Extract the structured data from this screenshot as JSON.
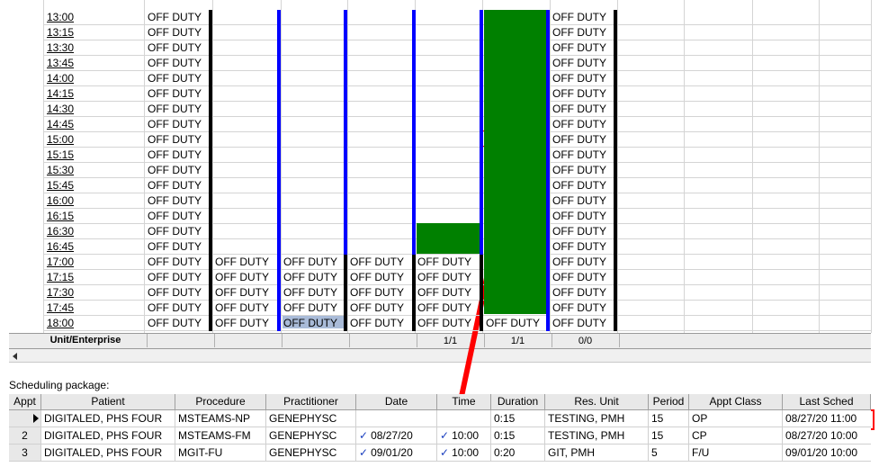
{
  "schedule": {
    "times": [
      "13:00",
      "13:15",
      "13:30",
      "13:45",
      "14:00",
      "14:15",
      "14:30",
      "14:45",
      "15:00",
      "15:15",
      "15:30",
      "15:45",
      "16:00",
      "16:15",
      "16:30",
      "16:45",
      "17:00",
      "17:15",
      "17:30",
      "17:45",
      "18:00"
    ],
    "off_duty": "OFF DUTY",
    "summary": {
      "label": "Unit/Enterprise",
      "values": [
        "",
        "",
        "",
        "",
        "1/1",
        "1/1",
        "0/0"
      ]
    }
  },
  "package": {
    "label": "Scheduling package:",
    "columns": [
      "Appt",
      "Patient",
      "Procedure",
      "Practitioner",
      "Date",
      "Time",
      "Duration",
      "Res. Unit",
      "Period",
      "Appt Class",
      "Last Sched"
    ],
    "rows": [
      {
        "appt": "",
        "patient": "DIGITALED, PHS FOUR",
        "procedure": "MSTEAMS-NP",
        "practitioner": "GENEPHYSC",
        "date": "",
        "time": "",
        "duration": "0:15",
        "res_unit": "TESTING, PMH",
        "period": "15",
        "appt_class": "OP",
        "last_sched": "08/27/20 11:00"
      },
      {
        "appt": "2",
        "patient": "DIGITALED, PHS FOUR",
        "procedure": "MSTEAMS-FM",
        "practitioner": "GENEPHYSC",
        "date": "08/27/20",
        "time": "10:00",
        "duration": "0:15",
        "res_unit": "TESTING, PMH",
        "period": "15",
        "appt_class": "CP",
        "last_sched": "08/27/20 10:00"
      },
      {
        "appt": "3",
        "patient": "DIGITALED, PHS FOUR",
        "procedure": "MGIT-FU",
        "practitioner": "GENEPHYSC",
        "date": "09/01/20",
        "time": "10:00",
        "duration": "0:20",
        "res_unit": "GIT, PMH",
        "period": "5",
        "appt_class": "F/U",
        "last_sched": "09/01/20 10:00"
      }
    ]
  },
  "colors": {
    "available": "#008000",
    "blocked": "#0000ff",
    "highlight": "#ff0000"
  },
  "icons": {
    "row_pointer": "triangle-right-icon",
    "checkmark": "check-icon",
    "scroll_left": "arrow-left-icon"
  }
}
